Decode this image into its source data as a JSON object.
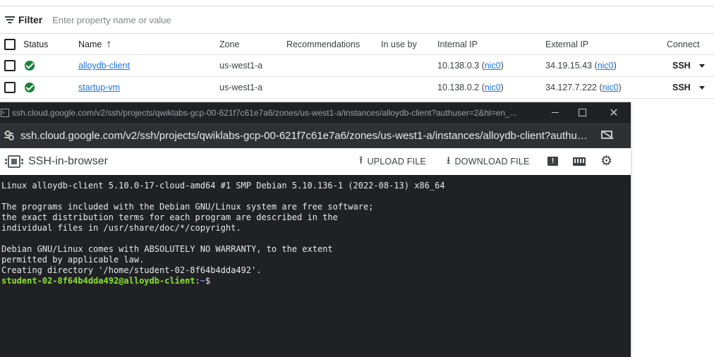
{
  "filter": {
    "label": "Filter",
    "placeholder": "Enter property name or value"
  },
  "table": {
    "columns": {
      "status": "Status",
      "name": "Name",
      "name_sort": "↑",
      "zone": "Zone",
      "recommendations": "Recommendations",
      "in_use_by": "In use by",
      "internal_ip": "Internal IP",
      "external_ip": "External IP",
      "connect": "Connect"
    },
    "rows": [
      {
        "name": "alloydb-client",
        "zone": "us-west1-a",
        "internal_ip": "10.138.0.3",
        "internal_nic": "nic0",
        "external_ip": "34.19.15.43",
        "external_nic": "nic0",
        "connect": "SSH"
      },
      {
        "name": "startup-vm",
        "zone": "us-west1-a",
        "internal_ip": "10.138.0.2",
        "internal_nic": "nic0",
        "external_ip": "34.127.7.222",
        "external_nic": "nic0",
        "connect": "SSH"
      }
    ]
  },
  "window": {
    "title": "ssh.cloud.google.com/v2/ssh/projects/qwiklabs-gcp-00-621f7c61e7a6/zones/us-west1-a/instances/alloydb-client?authuser=2&hl=en_...",
    "url": "ssh.cloud.google.com/v2/ssh/projects/qwiklabs-gcp-00-621f7c61e7a6/zones/us-west1-a/instances/alloydb-client?authuser=2..."
  },
  "ssh": {
    "title": "SSH-in-browser",
    "upload_label": "UPLOAD FILE",
    "download_label": "DOWNLOAD FILE"
  },
  "terminal": {
    "lines": [
      "Linux alloydb-client 5.10.0-17-cloud-amd64 #1 SMP Debian 5.10.136-1 (2022-08-13) x86_64",
      "",
      "The programs included with the Debian GNU/Linux system are free software;",
      "the exact distribution terms for each program are described in the",
      "individual files in /usr/share/doc/*/copyright.",
      "",
      "Debian GNU/Linux comes with ABSOLUTELY NO WARRANTY, to the extent",
      "permitted by applicable law.",
      "Creating directory '/home/student-02-8f64b4dda492'."
    ],
    "prompt_user": "student-02-8f64b4dda492@alloydb-client",
    "prompt_sep": ":",
    "prompt_cwd": "~",
    "prompt_end": "$"
  },
  "colors": {
    "status_ok": "#188038",
    "link": "#1a73e8",
    "prompt": "#8ae234",
    "terminal_bg": "#202124"
  }
}
